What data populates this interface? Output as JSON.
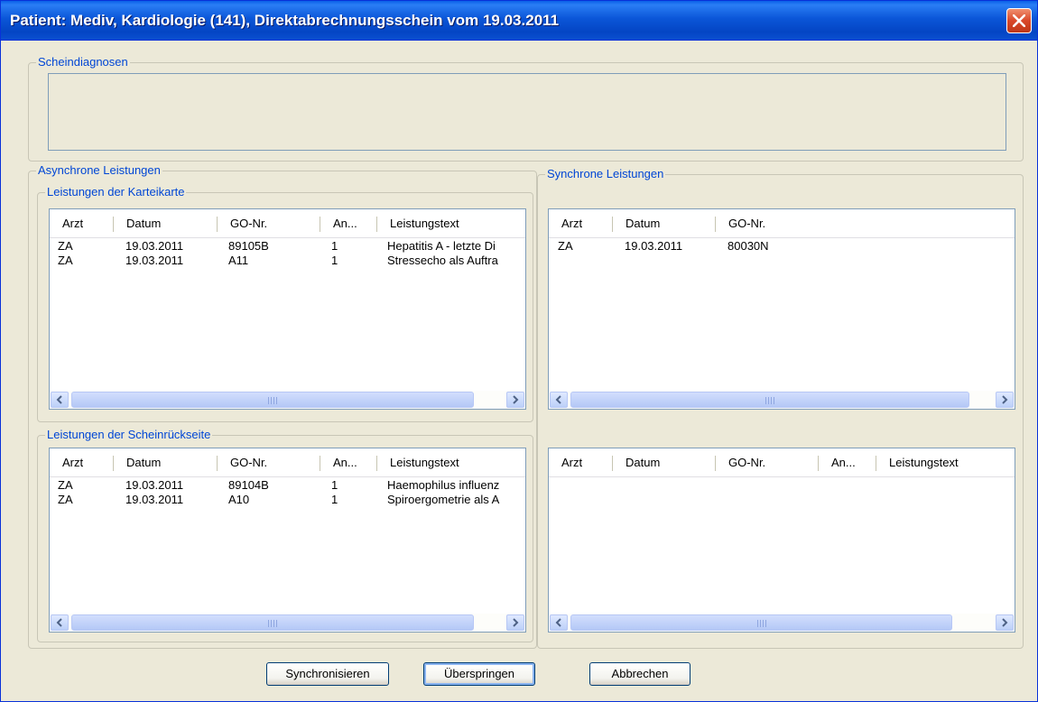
{
  "window": {
    "title": "Patient: Mediv, Kardiologie (141), Direktabrechnungsschein vom 19.03.2011"
  },
  "groups": {
    "scheindiagnosen": "Scheindiagnosen",
    "async": "Asynchrone Leistungen",
    "async_karteikarte": "Leistungen der Karteikarte",
    "async_rueckseite": "Leistungen der Scheinrückseite",
    "sync": "Synchrone Leistungen"
  },
  "async_karteikarte_list": {
    "columns": [
      "Arzt",
      "Datum",
      "GO-Nr.",
      "An...",
      "Leistungstext"
    ],
    "rows": [
      [
        "ZA",
        "19.03.2011",
        "89105B",
        "1",
        "Hepatitis A - letzte Di"
      ],
      [
        "ZA",
        "19.03.2011",
        "A11",
        "1",
        "Stressecho als Auftra"
      ]
    ],
    "scroll_grip": "III"
  },
  "sync_karteikarte_list": {
    "columns": [
      "Arzt",
      "Datum",
      "GO-Nr."
    ],
    "rows": [
      [
        "ZA",
        "19.03.2011",
        "80030N"
      ]
    ],
    "scroll_grip": "III"
  },
  "async_rueckseite_list": {
    "columns": [
      "Arzt",
      "Datum",
      "GO-Nr.",
      "An...",
      "Leistungstext"
    ],
    "rows": [
      [
        "ZA",
        "19.03.2011",
        "89104B",
        "1",
        "Haemophilus influenz"
      ],
      [
        "ZA",
        "19.03.2011",
        "A10",
        "1",
        "Spiroergometrie als A"
      ]
    ],
    "scroll_grip": "III"
  },
  "sync_rueckseite_list": {
    "columns": [
      "Arzt",
      "Datum",
      "GO-Nr.",
      "An...",
      "Leistungstext"
    ],
    "rows": [],
    "scroll_grip": "III"
  },
  "buttons": {
    "synchronisieren": "Synchronisieren",
    "ueberspringen": "Überspringen",
    "abbrechen": "Abbrechen"
  },
  "icons": {
    "close": "close-icon",
    "scroll_left": "arrow-left-icon",
    "scroll_right": "arrow-right-icon"
  }
}
